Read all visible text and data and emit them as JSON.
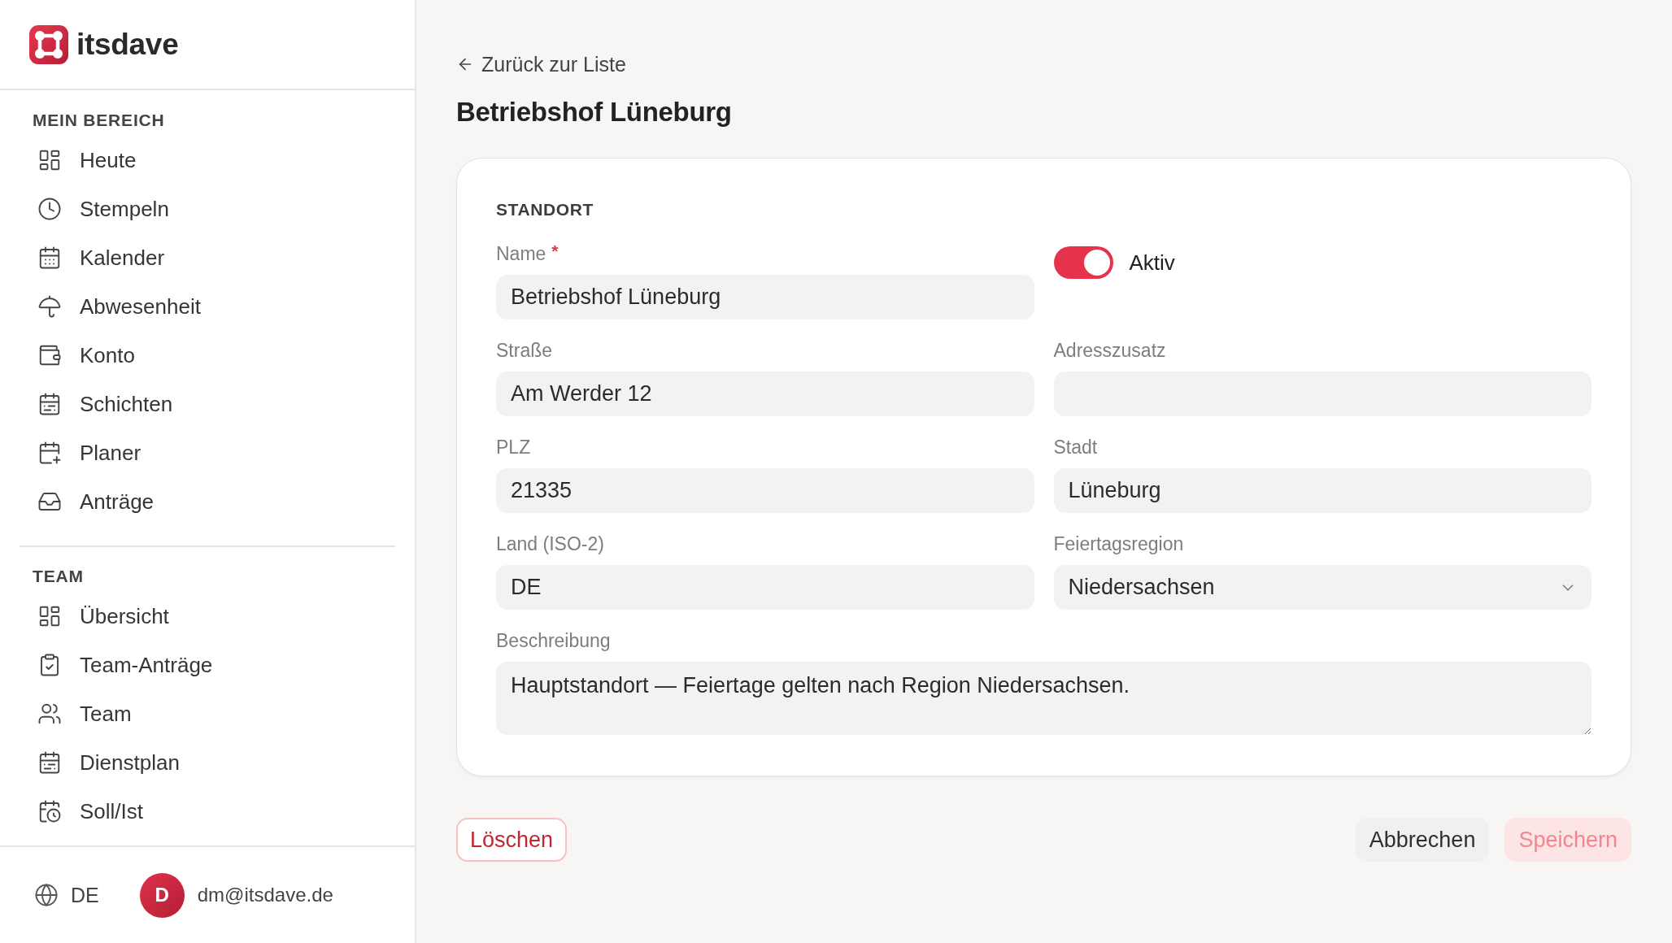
{
  "sidebar": {
    "logo": {
      "name": "itsdave"
    },
    "sections": [
      {
        "title": "MEIN BEREICH",
        "items": [
          {
            "label": "Heute",
            "selected": false
          },
          {
            "label": "Stempeln",
            "selected": false
          },
          {
            "label": "Kalender",
            "selected": false
          },
          {
            "label": "Abwesenheit",
            "selected": false
          },
          {
            "label": "Konto",
            "selected": false
          },
          {
            "label": "Schichten",
            "selected": false
          },
          {
            "label": "Planer",
            "selected": false
          },
          {
            "label": "Anträge",
            "selected": false
          }
        ]
      },
      {
        "title": "TEAM",
        "items": [
          {
            "label": "Übersicht",
            "selected": false
          },
          {
            "label": "Team-Anträge",
            "selected": false
          },
          {
            "label": "Team",
            "selected": false
          },
          {
            "label": "Dienstplan",
            "selected": false
          },
          {
            "label": "Soll/Ist",
            "selected": false
          }
        ]
      }
    ],
    "footer": {
      "language": "DE",
      "user": {
        "initial": "D",
        "email": "dm@itsdave.de"
      }
    }
  },
  "back_link": {
    "label": "Zurück zur Liste"
  },
  "title": "Betriebshof Lüneburg",
  "form": {
    "section_title": "STANDORT",
    "fields": [
      {
        "kind": "text",
        "label": "Name",
        "required_mark": "*",
        "value": "Betriebshof Lüneburg"
      },
      {
        "kind": "toggle",
        "label": "Aktiv",
        "on": true
      },
      {
        "kind": "text",
        "label": "Straße",
        "value": "Am Werder 12"
      },
      {
        "kind": "text",
        "label": "Adresszusatz"
      },
      {
        "kind": "text",
        "label": "PLZ",
        "value": "21335"
      },
      {
        "kind": "text",
        "label": "Stadt",
        "value": "Lüneburg"
      },
      {
        "kind": "text",
        "label": "Land (ISO-2)",
        "value": "DE"
      },
      {
        "kind": "select",
        "label": "Feiertagsregion",
        "value": "Niedersachsen"
      },
      {
        "kind": "textarea",
        "label": "Beschreibung",
        "value": "Hauptstandort — Feiertage gelten nach Region Niedersachsen."
      }
    ]
  },
  "actions": [
    {
      "kind": "danger",
      "label": "Löschen",
      "disabled": false
    },
    {
      "kind": "secondary",
      "label": "Abbrechen",
      "disabled": false
    },
    {
      "kind": "primary",
      "label": "Speichern",
      "disabled": true
    }
  ]
}
